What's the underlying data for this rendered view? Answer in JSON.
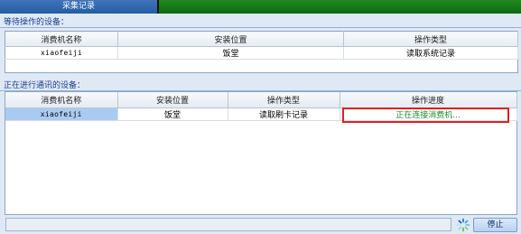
{
  "tab": {
    "title": "采集记录"
  },
  "waiting": {
    "label": "等待操作的设备：",
    "headers": [
      "消费机名称",
      "安装位置",
      "操作类型"
    ],
    "rows": [
      {
        "name": "xiaofeiji",
        "location": "饭堂",
        "op": "读取系统记录"
      }
    ]
  },
  "active": {
    "label": "正在进行通讯的设备：",
    "headers": [
      "消费机名称",
      "安装位置",
      "操作类型",
      "操作进度"
    ],
    "rows": [
      {
        "name": "xiaofeiji",
        "location": "饭堂",
        "op": "读取刷卡记录",
        "progress": "正在连接消费机..."
      }
    ]
  },
  "footer": {
    "stop_label": "停止"
  },
  "colors": {
    "tab": "#2f69b0",
    "topbar": "#138015",
    "highlight": "#e02020",
    "progress_text": "#1f8a2f"
  },
  "icons": {
    "spinner": "busy-spinner-icon"
  }
}
